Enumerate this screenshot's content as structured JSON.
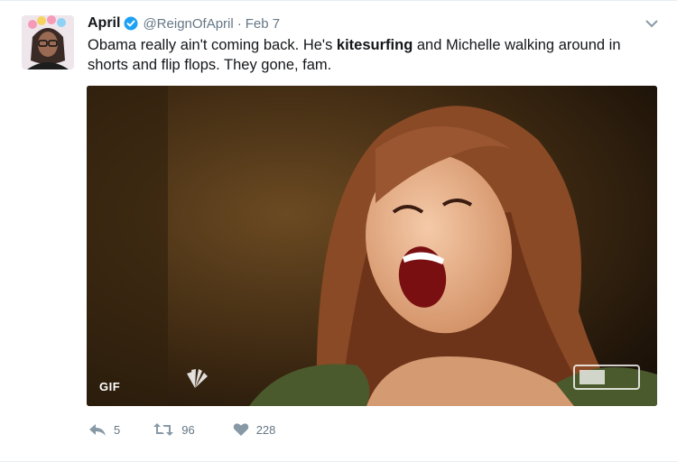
{
  "tweet": {
    "display_name": "April",
    "handle": "@ReignOfApril",
    "separator": "·",
    "timestamp": "Feb 7",
    "text_parts": {
      "a": "Obama really ain't coming back. He's ",
      "b": "kitesurfing",
      "c": " and Michelle walking around in shorts and flip flops. They gone, fam."
    },
    "media": {
      "badge": "GIF"
    },
    "actions": {
      "reply_count": "5",
      "retweet_count": "96",
      "like_count": "228"
    }
  },
  "colors": {
    "verified": "#1da1f2",
    "muted": "#657786",
    "text": "#14171a"
  },
  "icons": [
    "verified-badge-icon",
    "chevron-down-icon",
    "reply-icon",
    "retweet-icon",
    "heart-icon",
    "nbc-peacock-icon"
  ]
}
